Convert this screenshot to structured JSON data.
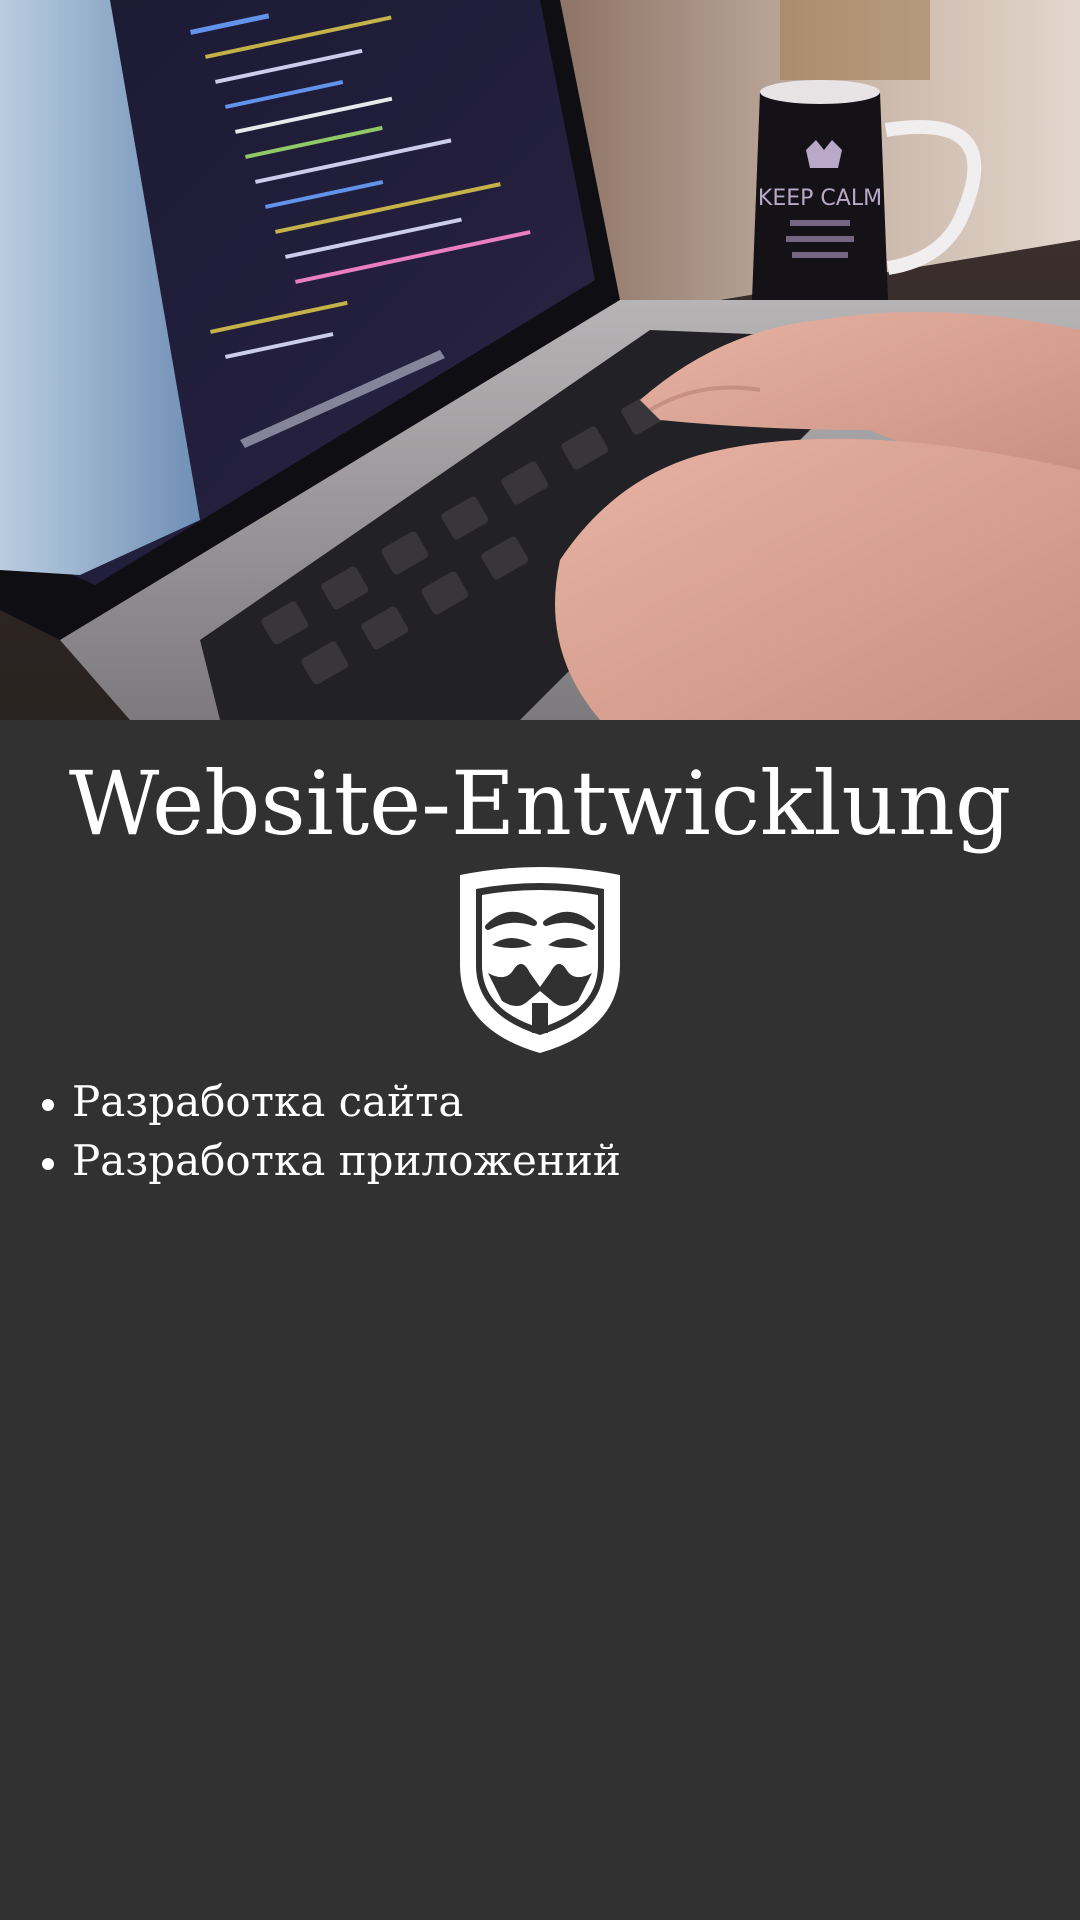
{
  "hero": {
    "image_icon": "laptop-coding-photo",
    "mug_text": "KEEP CALM"
  },
  "title": "Website-Entwicklung",
  "logo": {
    "icon": "guy-fawkes-mask-icon"
  },
  "services": [
    {
      "label": "Разработка сайта"
    },
    {
      "label": "Разработка приложений"
    }
  ],
  "colors": {
    "background": "#313131",
    "text": "#ffffff"
  }
}
